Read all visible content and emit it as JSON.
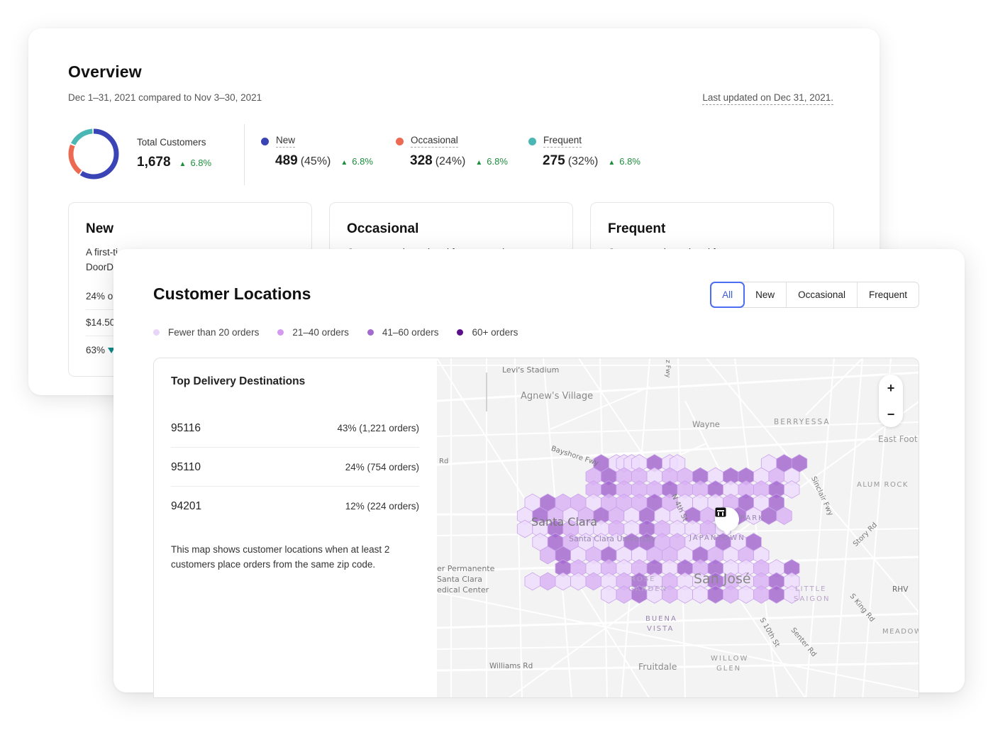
{
  "overview": {
    "title": "Overview",
    "subtitle": "Dec 1–31, 2021 compared to Nov 3–30, 2021",
    "last_updated": "Last updated on Dec 31, 2021.",
    "total": {
      "label": "Total Customers",
      "value": "1,678",
      "delta": "6.8%",
      "delta_direction": "up"
    },
    "donut_shares": [
      {
        "segment": "New",
        "share": 0.6,
        "color": "#3b44b5"
      },
      {
        "segment": "Occasional",
        "share": 0.22,
        "color": "#ec6a52"
      },
      {
        "segment": "Frequent",
        "share": 0.18,
        "color": "#4bb7b5"
      }
    ],
    "segments": [
      {
        "name": "New",
        "value": "489",
        "percent": "(45%)",
        "delta": "6.8%",
        "color": "#3b44b5"
      },
      {
        "name": "Occasional",
        "value": "328",
        "percent": "(24%)",
        "delta": "6.8%",
        "color": "#ec6a52"
      },
      {
        "name": "Frequent",
        "value": "275",
        "percent": "(32%)",
        "delta": "6.8%",
        "color": "#4bb7b5"
      }
    ],
    "cards": [
      {
        "title": "New",
        "desc_line1": "A first-ti",
        "desc_line2": "DoorD",
        "stats": [
          "24% o",
          "$14.50",
          "63%"
        ]
      },
      {
        "title": "Occasional",
        "desc_line1": "Customers who ordered from you at least t"
      },
      {
        "title": "Frequent",
        "desc_line1": "Customers who ordered from you most"
      }
    ]
  },
  "locations": {
    "title": "Customer Locations",
    "filters": [
      "All",
      "New",
      "Occasional",
      "Frequent"
    ],
    "active_filter": "All",
    "legend": [
      {
        "label": "Fewer than 20 orders",
        "color": "#e9d5f7"
      },
      {
        "label": "21–40 orders",
        "color": "#d49af0"
      },
      {
        "label": "41–60 orders",
        "color": "#a46bcf"
      },
      {
        "label": "60+ orders",
        "color": "#5b0f8c"
      }
    ],
    "top_destinations": {
      "title": "Top Delivery Destinations",
      "rows": [
        {
          "zip": "95116",
          "value": "43% (1,221 orders)"
        },
        {
          "zip": "95110",
          "value": "24% (754 orders)"
        },
        {
          "zip": "94201",
          "value": "12% (224 orders)"
        }
      ],
      "note": "This map shows customer locations when at least 2 customers place orders from the same zip code."
    },
    "map": {
      "zoom_in": "+",
      "zoom_out": "−",
      "labels": [
        {
          "text": "Levi's Stadium"
        },
        {
          "text": "Agnew's Village"
        },
        {
          "text": "Wayne"
        },
        {
          "text": "BERRYESSA"
        },
        {
          "text": "East Foot"
        },
        {
          "text": "Bayshore Fwy"
        },
        {
          "text": "Rd"
        },
        {
          "text": "ALUM ROCK"
        },
        {
          "text": "Santa Clara"
        },
        {
          "text": "Santa Clara University"
        },
        {
          "text": "JAPANTOWN"
        },
        {
          "text": "PARK"
        },
        {
          "text": "N 4th St"
        },
        {
          "text": "Sinclair Fwy"
        },
        {
          "text": "Story Rd"
        },
        {
          "text": "er Permanente"
        },
        {
          "text": "Santa Clara"
        },
        {
          "text": "edical Center"
        },
        {
          "text": "San José"
        },
        {
          "text": "ROSE"
        },
        {
          "text": "GARDEN"
        },
        {
          "text": "LITTLE"
        },
        {
          "text": "SAIGON"
        },
        {
          "text": "RHV"
        },
        {
          "text": "S King Rd"
        },
        {
          "text": "BUENA"
        },
        {
          "text": "VISTA"
        },
        {
          "text": "S 10th St"
        },
        {
          "text": "Senter Rd"
        },
        {
          "text": "MEADOW"
        },
        {
          "text": "Williams Rd"
        },
        {
          "text": "Fruitdale"
        },
        {
          "text": "WILLOW"
        },
        {
          "text": "GLEN"
        },
        {
          "text": "z Fwy"
        }
      ],
      "hex_density_rows": [
        "..........3.1111.3.11...........1.3.3",
        ".........2.3.2.2.1.2.2.3.1.3.3.1.2.1.",
        ".........2.3.2.2.2.3.2.2.3.1.2.2.3.1.",
        ".1.3.2.2.1.2.2.2.3.2.1.1.1.2.3.1.3...",
        "1.3.2.1.2.3.2.1.3.1.1.3.2.1.3.1.3.2..",
        "1.1.3.2.1.1.2.1.3.2.1.1.2.1..........",
        "..1.3.2.1.1.1.3.3.2.2.1.1.3.1.3......",
        "...2.3.1.2.3.1.1.2.2.1.3.2.1.2.1.....",
        ".....3.2.1.2.1.2.3.1.3.2.3.1.1.2.1.3.",
        ".1.2.1.1.2.1.2.3.1.2.1.1.3.2.1.2.3.1.",
        "...........1.2.3.1.2.1.1.3.2.1.2.3.1."
      ]
    }
  }
}
